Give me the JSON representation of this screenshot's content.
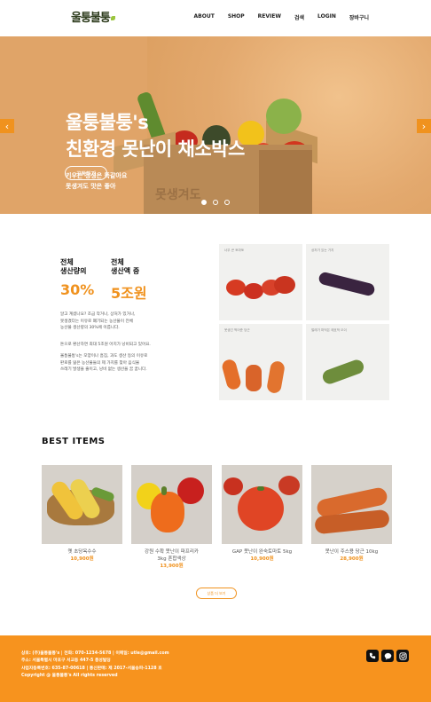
{
  "header": {
    "logo": "울퉁불퉁",
    "nav": [
      "ABOUT",
      "SHOP",
      "REVIEW",
      "검색",
      "LOGIN",
      "장바구니"
    ]
  },
  "hero": {
    "title_line1": "울퉁불퉁's",
    "title_line2": "친환경 못난이 채소박스",
    "sub_line1": "키우는 정성은 똑같아요",
    "sub_line2": "못생겨도 맛은 좋아",
    "button": "구독하기",
    "box_print": "못생겨도",
    "prev_icon": "‹",
    "next_icon": "›",
    "active_slide": 1,
    "slide_count": 3
  },
  "stats": [
    {
      "label_line1": "전체",
      "label_line2": "생산량의",
      "value": "30%"
    },
    {
      "label_line1": "전체",
      "label_line2": "생산액 중",
      "value": "5조원"
    }
  ],
  "description": [
    "알고 계셨나요? 조금 작거나, 상처가 있거나,",
    "못생겼다는 이유로 폐기되는 농산물이 전체",
    "농산물 생산량의 30%에 이릅니다.",
    "",
    "돈으로 환산하면 최대 5조원 어치가 낭비되고 있어요.",
    "",
    "울퉁불퉁's는 모양이나 흠짐, 과도 생산 등의 이유로",
    "판로를 잃은 농산물들의 제 가치를 찾아 음식물",
    "쓰레기 발생을 줄이고, 낭비 없는 생산을 꿈 꿉니다."
  ],
  "photos": [
    {
      "caption": "너무 큰 토마토"
    },
    {
      "caption": "상처가 있는 가지"
    },
    {
      "caption": "못생긴 찍어준 당근"
    },
    {
      "caption": "벌레가 파먹은 애호박 오이"
    }
  ],
  "best": {
    "title": "BEST ITEMS",
    "items": [
      {
        "name": "옛 초당옥수수",
        "price": "10,900원"
      },
      {
        "name": "강원 수확 못난이 파프리카",
        "name2": "3kg 혼합색상",
        "price": "13,900원"
      },
      {
        "name": "GAP 못난이 완숙토마토 5kg",
        "price": "10,900원"
      },
      {
        "name": "못난이 주스용 당근 10kg",
        "price": "28,900원"
      }
    ],
    "more_button": "상품 더 보기"
  },
  "footer": {
    "lines": [
      "상호: (주)울퉁불퉁's | 전화: 070-1234-5678 | 이메일: utle@gmail.com",
      "주소: 서울특별시 마포구 서교동 447-5 풍성빌딩",
      "사업자등록번호: 635-87-00618 | 통신판매: 제 2017-서울송파-1128 호",
      "Copyright @ 울퉁불퉁's All rights reserved"
    ],
    "social_icons": [
      "phone-icon",
      "chat-icon",
      "instagram-icon"
    ]
  },
  "colors": {
    "accent": "#f7931e",
    "hero_bg": "#e0a468",
    "product_bg": "#d6d1ca"
  }
}
